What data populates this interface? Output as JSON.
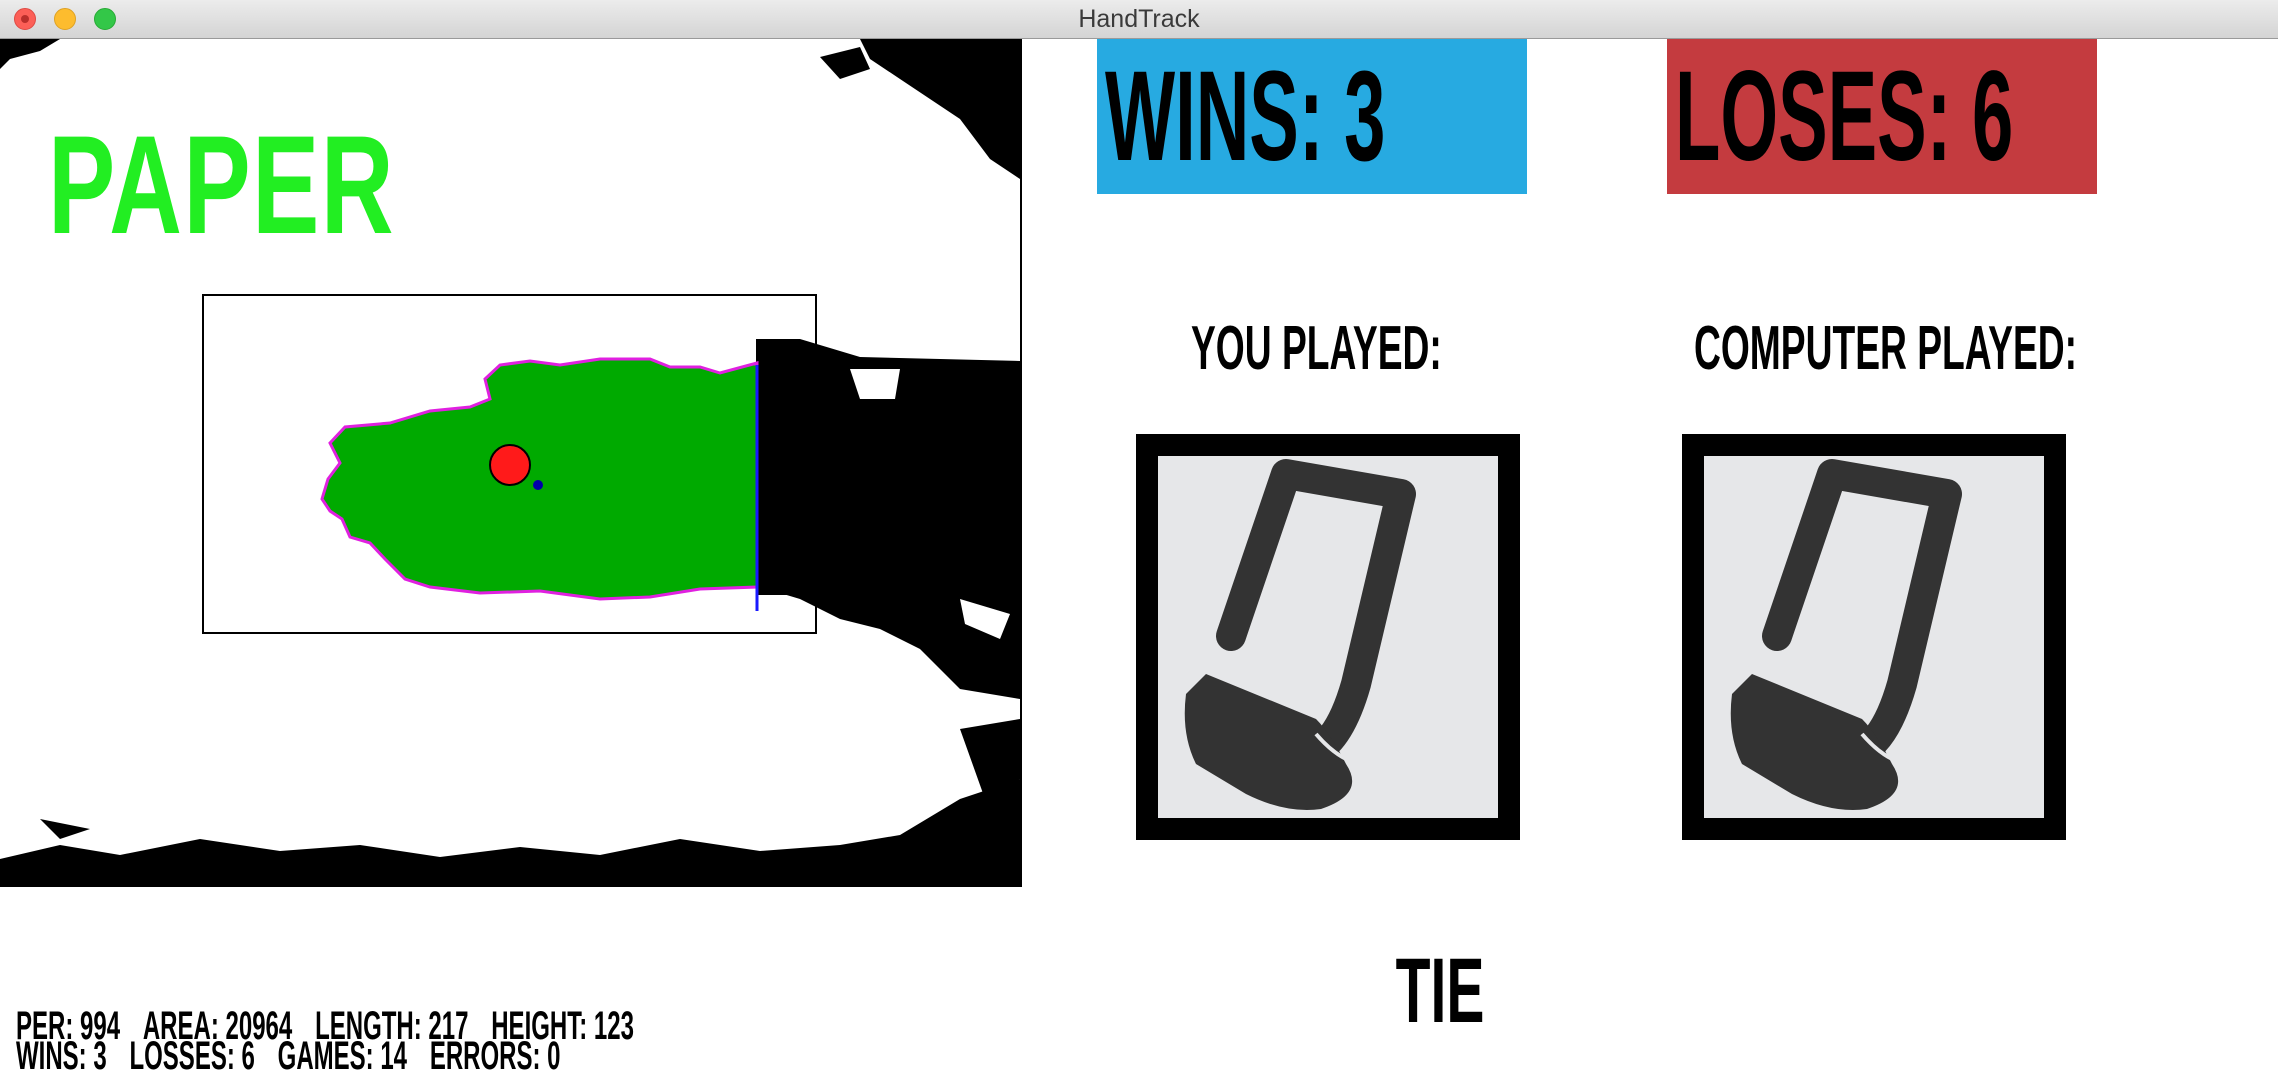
{
  "window": {
    "title": "HandTrack"
  },
  "camera": {
    "gesture_label": "PAPER",
    "gesture_color": "#22ee22",
    "hand_color": "#00aa00",
    "contour_color": "#e020e0"
  },
  "scoreboard": {
    "wins_label": "WINS: 3",
    "loses_label": "LOSES: 6",
    "wins_color": "#27aae1",
    "loses_color": "#c43b3f"
  },
  "you": {
    "label": "YOU PLAYED:",
    "icon": "paper-icon"
  },
  "computer": {
    "label": "COMPUTER PLAYED:",
    "icon": "paper-icon"
  },
  "result": "TIE",
  "stats": {
    "per": "PER: 994",
    "area": "AREA: 20964",
    "length": "LENGTH: 217",
    "height": "HEIGHT: 123",
    "wins": "WINS: 3",
    "losses": "LOSSES: 6",
    "games": "GAMES: 14",
    "errors": "ERRORS: 0"
  }
}
